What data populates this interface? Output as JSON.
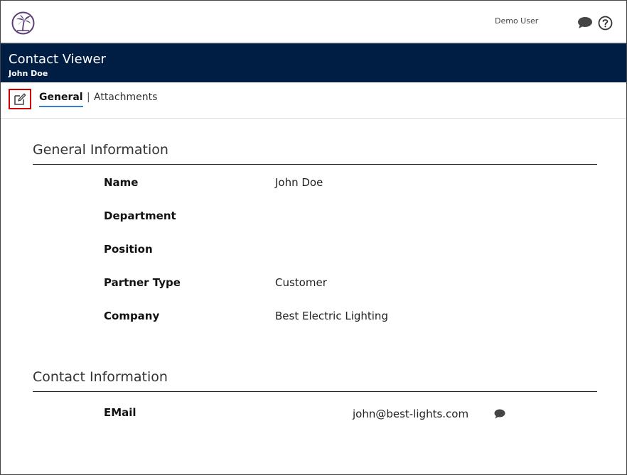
{
  "header": {
    "user_name": "Demo User"
  },
  "viewer": {
    "title": "Contact Viewer",
    "subtitle": "John Doe"
  },
  "tabs": {
    "general": "General",
    "separator": "|",
    "attachments": "Attachments"
  },
  "general_info": {
    "title": "General Information",
    "fields": [
      {
        "label": "Name",
        "value": "John Doe"
      },
      {
        "label": "Department",
        "value": ""
      },
      {
        "label": "Position",
        "value": ""
      },
      {
        "label": "Partner Type",
        "value": "Customer"
      },
      {
        "label": "Company",
        "value": "Best Electric Lighting"
      }
    ]
  },
  "contact_info": {
    "title": "Contact Information",
    "email_label": "EMail",
    "email_value": "john@best-lights.com"
  },
  "icons": {
    "logo": "palm-tree-logo-icon",
    "chat": "chat-bubble-icon",
    "help": "help-circle-icon",
    "edit": "edit-pencil-icon"
  },
  "colors": {
    "title_bar": "#001e44",
    "active_tab_underline": "#3a7bd5",
    "edit_highlight": "#d00000",
    "logo": "#5b3f7a"
  }
}
